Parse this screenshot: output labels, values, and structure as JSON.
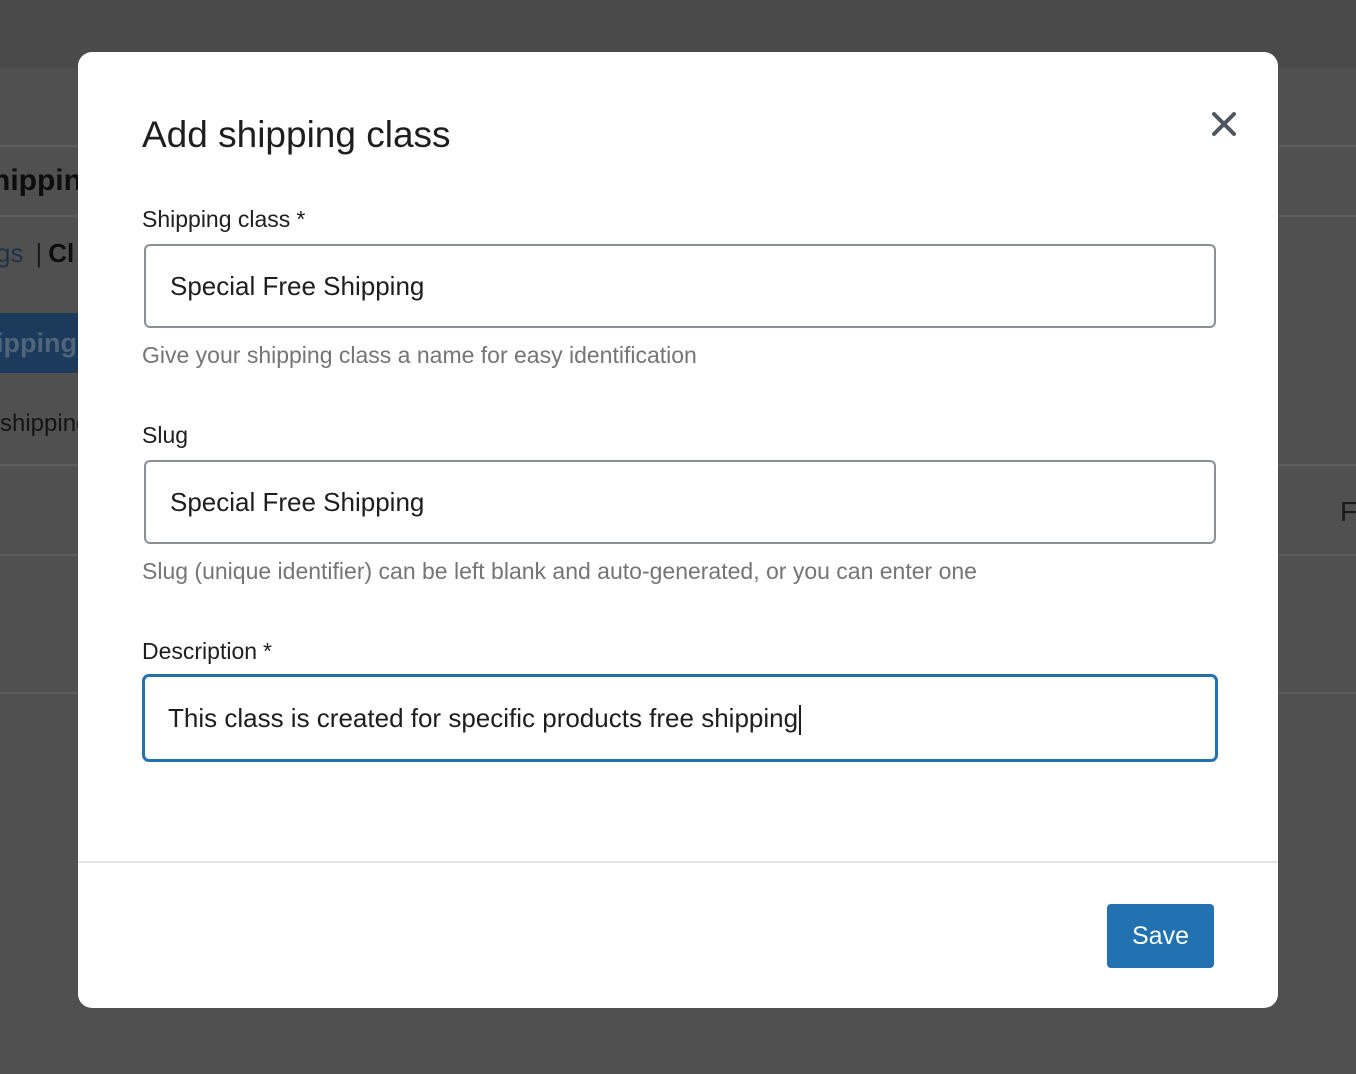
{
  "background": {
    "heading": "hippin",
    "subnav_link": "gs",
    "subnav_separator": "|",
    "subnav_current": "Cl",
    "primary_button": "ipping",
    "description": "shipping",
    "right_label": "F"
  },
  "modal": {
    "title": "Add shipping class",
    "close_icon": "close-icon",
    "fields": {
      "shipping_class": {
        "label": "Shipping class",
        "required_mark": "*",
        "value": "Special Free Shipping",
        "help": "Give your shipping class a name for easy identification"
      },
      "slug": {
        "label": "Slug",
        "value": "Special Free Shipping",
        "help": "Slug (unique identifier) can be left blank and auto-generated, or you can enter one"
      },
      "description": {
        "label": "Description",
        "required_mark": "*",
        "value": "This class is created for specific products free shipping"
      }
    },
    "save_label": "Save"
  },
  "colors": {
    "overlay": "#505050",
    "primary": "#2271b1",
    "input_border": "#8c8f94",
    "help_text": "#757575"
  }
}
